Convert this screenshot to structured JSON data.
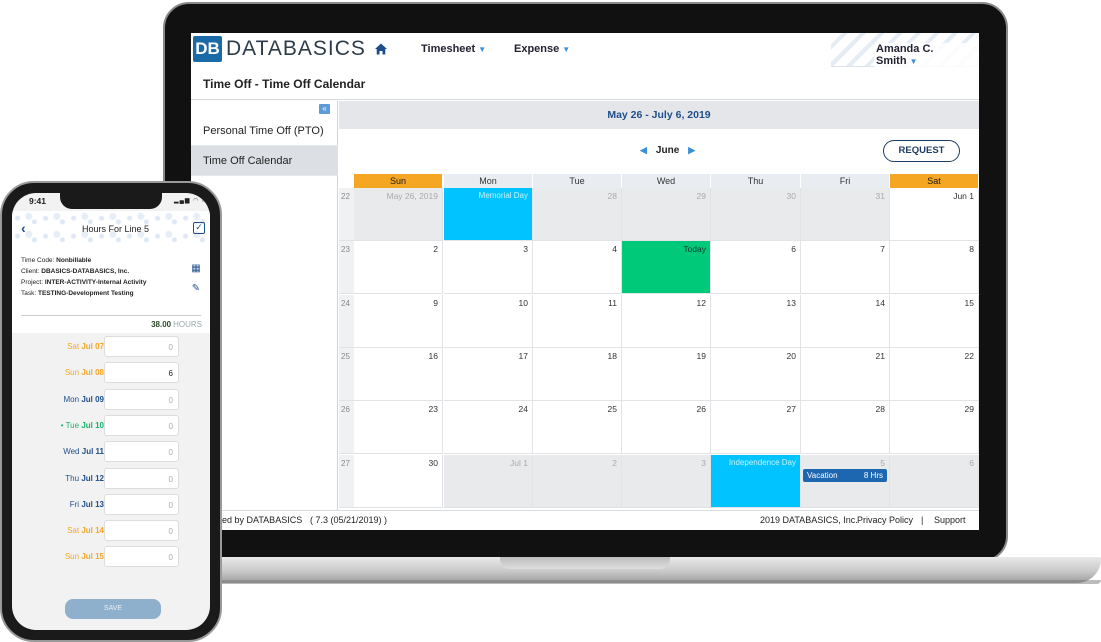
{
  "app": {
    "logo_short": "DB",
    "logo_name": "DATABASICS",
    "nav": [
      {
        "label": "Timesheet"
      },
      {
        "label": "Expense"
      }
    ],
    "user": "Amanda C. Smith",
    "page_title": "Time Off - Time Off Calendar"
  },
  "sidebar": {
    "collapse_icon": "«",
    "items": [
      {
        "label": "Personal Time Off (PTO)"
      },
      {
        "label": "Time Off Calendar"
      }
    ]
  },
  "calendar": {
    "date_range": "May 26 - July 6, 2019",
    "month": "June",
    "request_label": "REQUEST",
    "days_of_week": [
      "Sun",
      "Mon",
      "Tue",
      "Wed",
      "Thu",
      "Fri",
      "Sat"
    ],
    "weeks": [
      {
        "num": "22",
        "days": [
          {
            "label": "May 26, 2019",
            "out": true
          },
          {
            "label": "27",
            "holiday": "Memorial Day"
          },
          {
            "label": "28",
            "out": true
          },
          {
            "label": "29",
            "out": true
          },
          {
            "label": "30",
            "out": true
          },
          {
            "label": "31",
            "out": true
          },
          {
            "label": "Jun 1"
          }
        ]
      },
      {
        "num": "23",
        "days": [
          {
            "label": "2"
          },
          {
            "label": "3"
          },
          {
            "label": "4"
          },
          {
            "label": "Today",
            "today": true
          },
          {
            "label": "6"
          },
          {
            "label": "7"
          },
          {
            "label": "8"
          }
        ]
      },
      {
        "num": "24",
        "days": [
          {
            "label": "9"
          },
          {
            "label": "10"
          },
          {
            "label": "11"
          },
          {
            "label": "12"
          },
          {
            "label": "13"
          },
          {
            "label": "14"
          },
          {
            "label": "15"
          }
        ]
      },
      {
        "num": "25",
        "days": [
          {
            "label": "16"
          },
          {
            "label": "17"
          },
          {
            "label": "18"
          },
          {
            "label": "19"
          },
          {
            "label": "20"
          },
          {
            "label": "21"
          },
          {
            "label": "22"
          }
        ]
      },
      {
        "num": "26",
        "days": [
          {
            "label": "23"
          },
          {
            "label": "24"
          },
          {
            "label": "25"
          },
          {
            "label": "26"
          },
          {
            "label": "27"
          },
          {
            "label": "28"
          },
          {
            "label": "29"
          }
        ]
      },
      {
        "num": "27",
        "days": [
          {
            "label": "30"
          },
          {
            "label": "Jul 1",
            "out": true
          },
          {
            "label": "2",
            "out": true
          },
          {
            "label": "3",
            "out": true
          },
          {
            "label": "4",
            "holiday": "Independence Day"
          },
          {
            "label": "5",
            "out": true,
            "event": {
              "name": "Vacation",
              "hours": "8 Hrs"
            }
          },
          {
            "label": "6",
            "out": true
          }
        ]
      }
    ]
  },
  "footer": {
    "powered": "ered by DATABASICS",
    "version": "( 7.3 (05/21/2019) )",
    "copyright": "2019 DATABASICS, Inc.",
    "privacy": "Privacy Policy",
    "divider": "|",
    "support": "Support"
  },
  "phone": {
    "time": "9:41",
    "status": "▂▄▆ ◠ ▭",
    "title": "Hours For Line 5",
    "details": [
      {
        "key": "Time Code:",
        "value": "Nonbillable"
      },
      {
        "key": "Client:",
        "value": "DBASICS-DATABASICS, Inc."
      },
      {
        "key": "Project:",
        "value": "INTER-ACTIVITY-Internal Activity"
      },
      {
        "key": "Task:",
        "value": "TESTING-Development Testing"
      }
    ],
    "total": "38.00",
    "total_unit": "HOURS",
    "rows": [
      {
        "dow": "Sat",
        "date": "Jul 07",
        "value": "0",
        "color": "#f5a623",
        "prefix": ""
      },
      {
        "dow": "Sun",
        "date": "Jul 08",
        "value": "6",
        "color": "#f5a623",
        "prefix": ""
      },
      {
        "dow": "Mon",
        "date": "Jul 09",
        "value": "0",
        "color": "#1f4f8a",
        "prefix": ""
      },
      {
        "dow": "Tue",
        "date": "Jul 10",
        "value": "0",
        "color": "#17b26a",
        "prefix": "• "
      },
      {
        "dow": "Wed",
        "date": "Jul 11",
        "value": "0",
        "color": "#1f4f8a",
        "prefix": ""
      },
      {
        "dow": "Thu",
        "date": "Jul 12",
        "value": "0",
        "color": "#1f4f8a",
        "prefix": ""
      },
      {
        "dow": "Fri",
        "date": "Jul 13",
        "value": "0",
        "color": "#1f4f8a",
        "prefix": ""
      },
      {
        "dow": "Sat",
        "date": "Jul 14",
        "value": "0",
        "color": "#f5a623",
        "prefix": ""
      },
      {
        "dow": "Sun",
        "date": "Jul 15",
        "value": "0",
        "color": "#f5a623",
        "prefix": ""
      }
    ],
    "save_label": "SAVE"
  }
}
